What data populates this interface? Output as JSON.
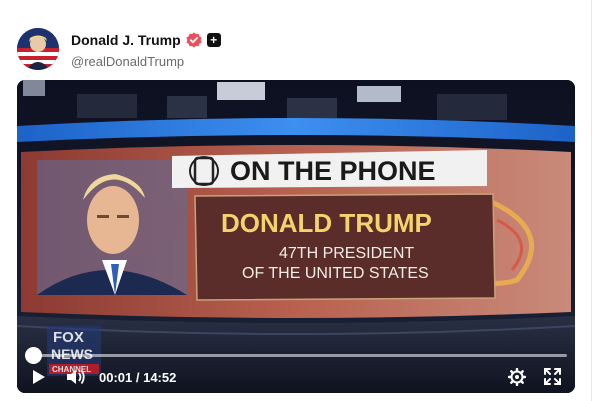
{
  "post": {
    "display_name": "Donald J. Trump",
    "handle": "@realDonaldTrump",
    "plus_badge": "+"
  },
  "video": {
    "banner_title": "ON THE PHONE",
    "lower_third_name": "DONALD TRUMP",
    "lower_third_subtitle_line1": "47TH PRESIDENT",
    "lower_third_subtitle_line2": "OF THE UNITED STATES",
    "network_logo_line1": "FOX",
    "network_logo_line2": "NEWS",
    "network_logo_line3": "CHANNEL",
    "current_time": "00:01",
    "time_separator": " / ",
    "duration": "14:52",
    "progress_fraction": 0.001
  },
  "colors": {
    "verified_badge": "#e8505b",
    "lower_third_gold": "#f3d36b",
    "banner_bg": "#f1f1f1",
    "lower_third_bg": "#5a2c2a"
  },
  "icons": [
    "verified-badge-icon",
    "plus-icon",
    "play-icon",
    "volume-icon",
    "settings-gear-icon",
    "fullscreen-icon",
    "phone-icon"
  ]
}
